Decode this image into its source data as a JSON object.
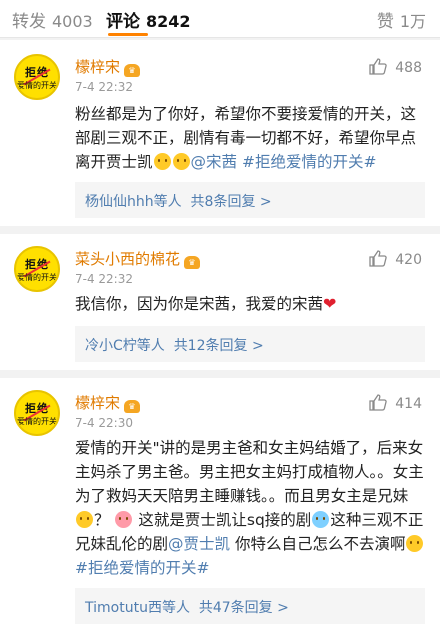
{
  "tabs": {
    "repost_label": "转发",
    "repost_count": "4003",
    "comment_label": "评论",
    "comment_count": "8242",
    "like_label": "赞",
    "like_count": "1万"
  },
  "colors": {
    "accent": "#ff8200",
    "link": "#507daf",
    "username": "#e07b00"
  },
  "comments": [
    {
      "username": "檬梓宋",
      "time": "7-4 22:32",
      "likes": "488",
      "avatar_text": [
        "拒绝",
        "爱情的开关"
      ],
      "text_plain": "粉丝都是为了你好，希望你不要接爱情的开关，这部剧三观不正，剧情有毒一切都不好，希望你早点离开贾士凯",
      "mention": "@宋茜",
      "hashtag": "#拒绝爱情的开关#",
      "reply_summary": "杨仙仙hhh等人",
      "reply_count": "共8条回复 >"
    },
    {
      "username": "菜头小西的棉花",
      "time": "7-4 22:32",
      "likes": "420",
      "avatar_text": [
        "拒绝",
        "爱情的开关"
      ],
      "text_plain": "我信你，因为你是宋茜，我爱的宋茜",
      "reply_summary": "冷小C柠等人",
      "reply_count": "共12条回复 >"
    },
    {
      "username": "檬梓宋",
      "time": "7-4 22:30",
      "likes": "414",
      "avatar_text": [
        "拒绝",
        "爱情的开关"
      ],
      "text_part1": "爱情的开关\"讲的是男主爸和女主妈结婚了，后来女主妈杀了男主爸。男主把女主妈打成植物人。。女主为了救妈天天陪男主睡赚钱。。而且男女主是兄妹",
      "text_part2": "？",
      "text_part3": "这就是贾士凯让sq接的剧",
      "text_part4": "这种三观不正兄妹乱伦的剧",
      "mention": "@贾士凯",
      "text_part5": " 你特么自己怎么不去演啊",
      "hashtag": "#拒绝爱情的开关#",
      "reply_summary": "Timotutu西等人",
      "reply_count": "共47条回复 >"
    }
  ]
}
